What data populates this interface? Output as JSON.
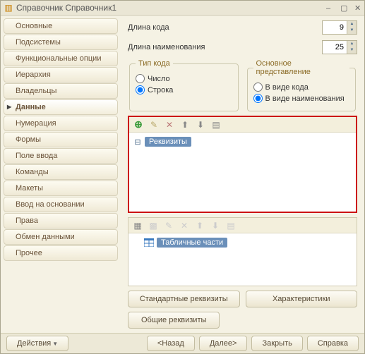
{
  "window": {
    "title": "Справочник Справочник1"
  },
  "sidebar": {
    "items": [
      {
        "label": "Основные"
      },
      {
        "label": "Подсистемы"
      },
      {
        "label": "Функциональные опции"
      },
      {
        "label": "Иерархия"
      },
      {
        "label": "Владельцы"
      },
      {
        "label": "Данные"
      },
      {
        "label": "Нумерация"
      },
      {
        "label": "Формы"
      },
      {
        "label": "Поле ввода"
      },
      {
        "label": "Команды"
      },
      {
        "label": "Макеты"
      },
      {
        "label": "Ввод на основании"
      },
      {
        "label": "Права"
      },
      {
        "label": "Обмен данными"
      },
      {
        "label": "Прочее"
      }
    ]
  },
  "fields": {
    "code_length_label": "Длина кода",
    "code_length_value": "9",
    "name_length_label": "Длина наименования",
    "name_length_value": "25"
  },
  "code_type": {
    "legend": "Тип кода",
    "number": "Число",
    "string": "Строка",
    "selected": "string"
  },
  "main_rep": {
    "legend": "Основное представление",
    "as_code": "В виде кода",
    "as_name": "В виде наименования",
    "selected": "as_name"
  },
  "attributes_panel": {
    "root_label": "Реквизиты"
  },
  "tables_panel": {
    "root_label": "Табличные части"
  },
  "buttons": {
    "std_attrs": "Стандартные реквизиты",
    "characteristics": "Характеристики",
    "common_attrs": "Общие реквизиты",
    "actions": "Действия",
    "back": "<Назад",
    "next": "Далее>",
    "close": "Закрыть",
    "help": "Справка"
  }
}
